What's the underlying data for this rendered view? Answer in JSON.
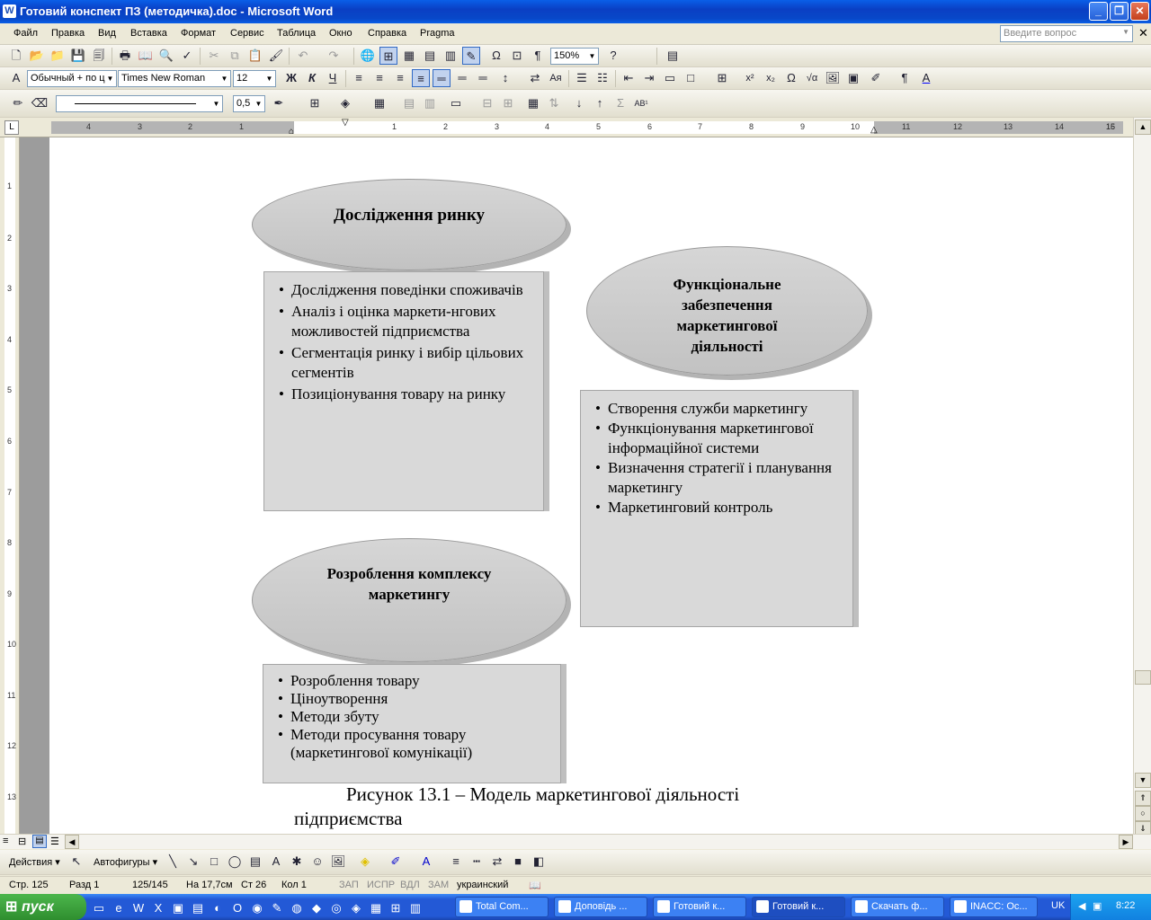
{
  "window": {
    "title": "Готовий конспект ПЗ (методичка).doc - Microsoft Word",
    "icon": "W"
  },
  "menu": {
    "items": [
      "Файл",
      "Правка",
      "Вид",
      "Вставка",
      "Формат",
      "Сервис",
      "Таблица",
      "Окно",
      "Справка",
      "Pragma"
    ],
    "help_placeholder": "Введите вопрос"
  },
  "standard_toolbar": {
    "zoom": "150%"
  },
  "formatting_toolbar": {
    "style": "Обычный + по ц",
    "font": "Times New Roman",
    "size": "12"
  },
  "drawing_props_toolbar": {
    "line_weight": "0,5"
  },
  "ruler": {
    "labels": [
      "4",
      "3",
      "2",
      "1",
      "1",
      "2",
      "3",
      "4",
      "5",
      "6",
      "7",
      "8",
      "9",
      "10",
      "11",
      "12",
      "13",
      "14",
      "15",
      "16"
    ]
  },
  "vruler": {
    "labels": [
      "1",
      "1",
      "2",
      "3",
      "4",
      "5",
      "6",
      "7",
      "8",
      "9",
      "10",
      "11",
      "12",
      "13"
    ]
  },
  "diagram": {
    "ellipse1": {
      "title": "Дослідження ринку"
    },
    "box1": {
      "items": [
        "Дослідження поведінки споживачів",
        "Аналіз і оцінка маркети-нгових можливостей підприємства",
        "Сегментація ринку і вибір цільових сегментів",
        "Позиціонування товару на ринку"
      ]
    },
    "ellipse2": {
      "line1": "Функціональне",
      "line2": "забезпечення",
      "line3": "маркетингової",
      "line4": "діяльності"
    },
    "box2": {
      "items": [
        "Створення служби маркетингу",
        "Функціонування маркетингової інформаційної системи",
        "Визначення стратегії і планування маркетингу",
        "Маркетинговий контроль"
      ]
    },
    "ellipse3": {
      "line1": "Розроблення комплексу",
      "line2": "маркетингу"
    },
    "box3": {
      "items": [
        "Розроблення товару",
        "Ціноутворення",
        "Методи збуту",
        "Методи просування товару (маркетингової комунікації)"
      ]
    },
    "caption_line1": "Рисунок 13.1 – Модель маркетингової діяльності",
    "caption_line2": "підприємства"
  },
  "drawing_toolbar": {
    "actions": "Действия",
    "autoshapes": "Автофигуры"
  },
  "status": {
    "page": "Стр. 125",
    "section": "Разд 1",
    "count": "125/145",
    "at": "На 17,7см",
    "line": "Ст 26",
    "col": "Кол 1",
    "rec": "ЗАП",
    "trk": "ИСПР",
    "ext": "ВДЛ",
    "ovr": "ЗАМ",
    "lang": "украинский"
  },
  "taskbar": {
    "start": "пуск",
    "buttons": [
      "Total Com...",
      "Доповідь ...",
      "Готовий к...",
      "Готовий к...",
      "Скачать ф...",
      "INACC: Ос..."
    ],
    "lang": "UK",
    "clock": "8:22"
  },
  "colors": {
    "title_blue": "#0a3fc4",
    "shape_gray": "#d9d9d9",
    "taskbar_blue": "#2359d6",
    "start_green": "#3a9b3a"
  }
}
